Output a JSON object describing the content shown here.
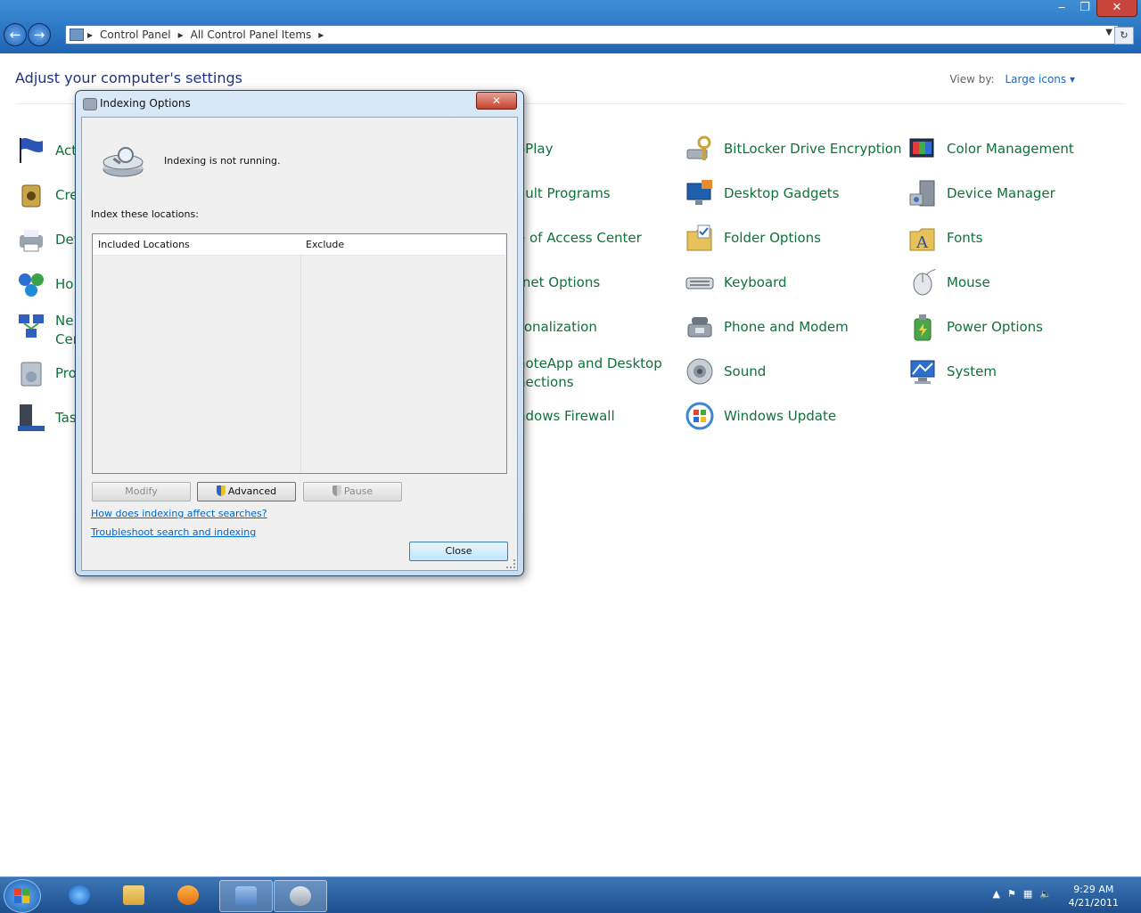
{
  "explorer": {
    "address_segments": [
      "Control Panel",
      "All Control Panel Items"
    ],
    "page_title": "Adjust your computer's settings",
    "view_by_label": "View by:",
    "view_by_value": "Large icons"
  },
  "control_panel_items": {
    "col1_partial": [
      "Act",
      "Cre",
      "Dev",
      "Ho",
      "Ne",
      "Cer",
      "Pro",
      "Tas"
    ],
    "col2_partial": [
      "oPlay",
      "ault Programs",
      "e of Access Center",
      "rnet Options",
      "sonalization",
      "noteApp and Desktop",
      "nections",
      "ndows Firewall"
    ],
    "col3": [
      "BitLocker Drive Encryption",
      "Desktop Gadgets",
      "Folder Options",
      "Keyboard",
      "Phone and Modem",
      "Sound",
      "Windows Update"
    ],
    "col4": [
      "Color Management",
      "Device Manager",
      "Fonts",
      "Mouse",
      "Power Options",
      "System"
    ]
  },
  "dialog": {
    "title": "Indexing Options",
    "status": "Indexing is not running.",
    "index_label": "Index these locations:",
    "columns": [
      "Included Locations",
      "Exclude"
    ],
    "buttons": {
      "modify": "Modify",
      "advanced": "Advanced",
      "pause": "Pause",
      "close": "Close"
    },
    "links": [
      "How does indexing affect searches?",
      "Troubleshoot search and indexing"
    ]
  },
  "taskbar": {
    "time": "9:29 AM",
    "date": "4/21/2011"
  },
  "icons": [
    "back-arrow-icon",
    "forward-arrow-icon",
    "control-panel-icon",
    "bitlocker-icon",
    "desktop-gadgets-icon",
    "folder-options-icon",
    "keyboard-icon",
    "phone-modem-icon",
    "sound-icon",
    "windows-update-icon",
    "color-management-icon",
    "device-manager-icon",
    "fonts-icon",
    "mouse-icon",
    "power-options-icon",
    "system-icon",
    "indexing-disk-icon",
    "shield-icon",
    "windows-start-icon"
  ],
  "colors": {
    "link_green": "#10713b",
    "heading_blue": "#1e3287",
    "hyperlink_blue": "#0066cc",
    "taskbar": "#1c4f8c"
  }
}
